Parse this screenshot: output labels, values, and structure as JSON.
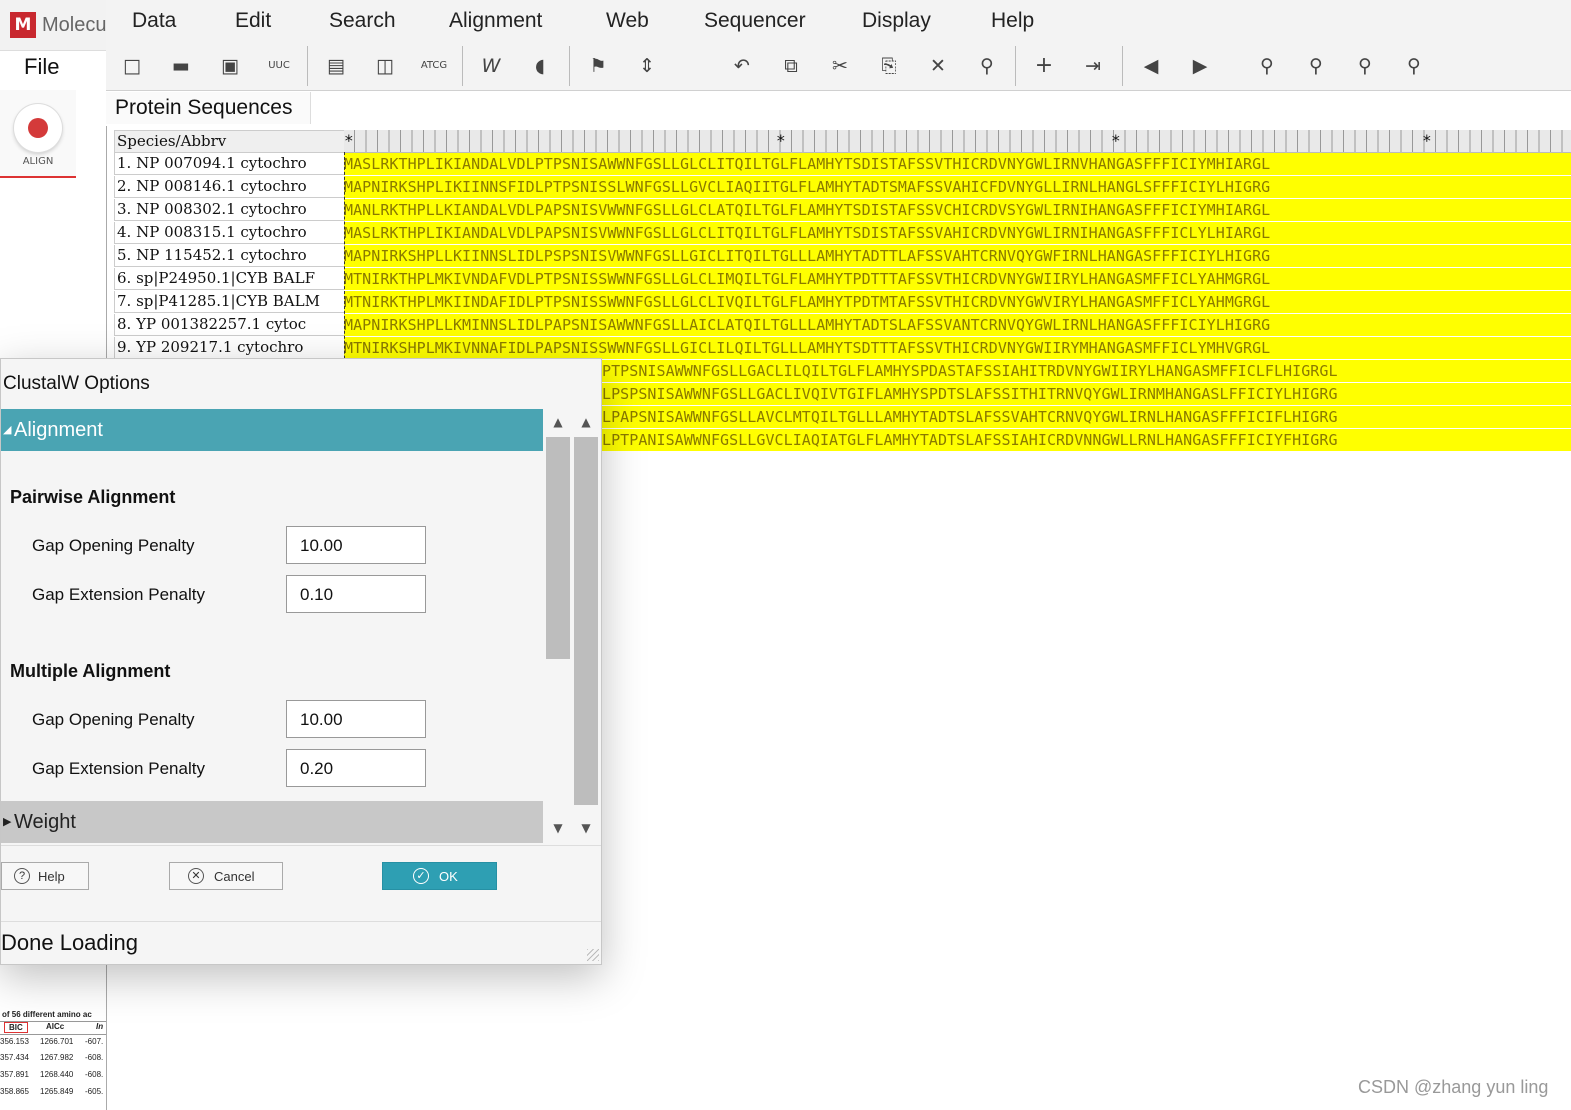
{
  "app": {
    "name": "Molecu",
    "logo_glyph": "M",
    "file_menu": "File",
    "align_tool_label": "ALIGN",
    "accent": "#c8282f"
  },
  "menubar": [
    "Data",
    "Edit",
    "Search",
    "Alignment",
    "Web",
    "Sequencer",
    "Display",
    "Help"
  ],
  "toolbar_icons": [
    "new-file-icon",
    "open-folder-icon",
    "save-icon",
    "uuc-translate-icon",
    "sheet-icon",
    "columns-icon",
    "atcg-icon",
    "w-align-icon",
    "muscle-icon",
    "flag-icon",
    "marker-icon",
    "undo-icon",
    "copy-icon",
    "cut-icon",
    "paste-icon",
    "delete-icon",
    "find-icon",
    "add-icon",
    "insert-icon",
    "previous-icon",
    "next-icon",
    "zoom-icon",
    "search-prev-icon",
    "search-next-icon",
    "search-clear-icon"
  ],
  "tab": {
    "label": "Protein Sequences"
  },
  "grid": {
    "header": "Species/Abbrv",
    "rows": [
      {
        "name": "1.  NP 007094.1 cytochro",
        "seq": "MASLRKTHPLIKIANDALVDLPTPSNISAWWNFGSLLGLCLITQILTGLFLAMHYTSDISTAFSSVTHICRDVNYGWLIRNVHANGASFFFICIYMHIARGL"
      },
      {
        "name": "2.  NP 008146.1 cytochro",
        "seq": "MAPNIRKSHPLIKIINNSFIDLPTPSNISSLWNFGSLLGVCLIAQIITGLFLAMHYTADTSMAFSSVAHICFDVNYGLLIRNLHANGLSFFFICIYLHIGRG"
      },
      {
        "name": "3.  NP 008302.1 cytochro",
        "seq": "MANLRKTHPLLKIANDALVDLPAPSNISVWWNFGSLLGLCLATQILTGLFLAMHYTSDISTAFSSVCHICRDVSYGWLIRNIHANGASFFFICIYMHIARGL"
      },
      {
        "name": "4.  NP 008315.1 cytochro",
        "seq": "MASLRKTHPLIKIANDALVDLPAPSNISVWWNFGSLLGLCLITQILTGLFLAMHYTSDISTAFSSVAHICRDVNYGWLIRNIHANGASFFFICLYLHIARGL"
      },
      {
        "name": "5.  NP 115452.1 cytochro",
        "seq": "MAPNIRKSHPLLKIINNSLIDLPSPSNISVWWNFGSLLGICLITQILTGLLLAMHYTADTTLAFSSVAHTCRNVQYGWFIRNLHANGASFFFICIYLHIGRG"
      },
      {
        "name": "6.  sp|P24950.1|CYB BALF",
        "seq": "MTNIRKTHPLMKIVNDAFVDLPTPSNISSWWNFGSLLGLCLIMQILTGLFLAMHYTPDTTTAFSSVTHICRDVNYGWIIRYLHANGASMFFICLYAHMGRGL"
      },
      {
        "name": "7.  sp|P41285.1|CYB BALM",
        "seq": "MTNIRKTHPLMKIINDAFIDLPTPSNISSWWNFGSLLGLCLIVQILTGLFLAMHYTPDTMTAFSSVTHICRDVNYGWVIRYLHANGASMFFICLYAHMGRGL"
      },
      {
        "name": "8.  YP 001382257.1 cytoc",
        "seq": "MAPNIRKSHPLLKMINNSLIDLPAPSNISAWWNFGSLLAICLATQILTGLLLAMHYTADTSLAFSSVANTCRNVQYGWLIRNLHANGASFFFICIYLHIGRG"
      },
      {
        "name": "9.  YP 209217.1 cytochro",
        "seq": "MTNIRKSHPLMKIVNNAFIDLPAPSNISSWWNFGSLLGICLILQILTGLLLAMHYTSDTTTAFSSVTHICRDVNYGWIIRYMHANGASMFFICLYMHVGRGL"
      },
      {
        "name": "",
        "seq": "PTPSNISAWWNFGSLLGACLILQILTGLFLAMHYSPDASTAFSSIAHITRDVNYGWIIRYLHANGASMFFICLFLHIGRGL"
      },
      {
        "name": "",
        "seq": "LPSPSNISAWWNFGSLLGACLIVQIVTGIFLAMHYSPDTSLAFSSITHITRNVQYGWLIRNMHANGASLFFICIYLHIGRG"
      },
      {
        "name": "",
        "seq": "LPAPSNISAWWNFGSLLAVCLMTQILTGLLLAMHYTADTSLAFSSVAHTCRNVQYGWLIRNLHANGASFFFICIFLHIGRG"
      },
      {
        "name": "",
        "seq": "LPTPANISAWWNFGSLLGVCLIAQIATGLFLAMHYTADTSLAFSSIAHICRDVNNGWLLRNLHANGASFFFICIYFHIGRG"
      }
    ],
    "highlight_color": "#ffff00"
  },
  "dialog": {
    "title": "ClustalW Options",
    "section_alignment": "Alignment",
    "section_weight": "Weight",
    "pairwise": {
      "title": "Pairwise Alignment",
      "gap_open_label": "Gap Opening Penalty",
      "gap_open_value": "10.00",
      "gap_ext_label": "Gap Extension Penalty",
      "gap_ext_value": "0.10"
    },
    "multiple": {
      "title": "Multiple Alignment",
      "gap_open_label": "Gap Opening Penalty",
      "gap_open_value": "10.00",
      "gap_ext_label": "Gap Extension Penalty",
      "gap_ext_value": "0.20"
    },
    "buttons": {
      "help": "Help",
      "cancel": "Cancel",
      "ok": "OK"
    },
    "status": "Done Loading",
    "accent": "#4aa4b3"
  },
  "mini_table": {
    "caption": "of 56 different amino ac",
    "headers": [
      "BIC",
      "AICc",
      "In"
    ],
    "rows": [
      [
        "356.153",
        "1266.701",
        "-607."
      ],
      [
        "357.434",
        "1267.982",
        "-608."
      ],
      [
        "357.891",
        "1268.440",
        "-608."
      ],
      [
        "358.865",
        "1265.849",
        "-605."
      ]
    ]
  },
  "watermark": "CSDN @zhang yun ling"
}
